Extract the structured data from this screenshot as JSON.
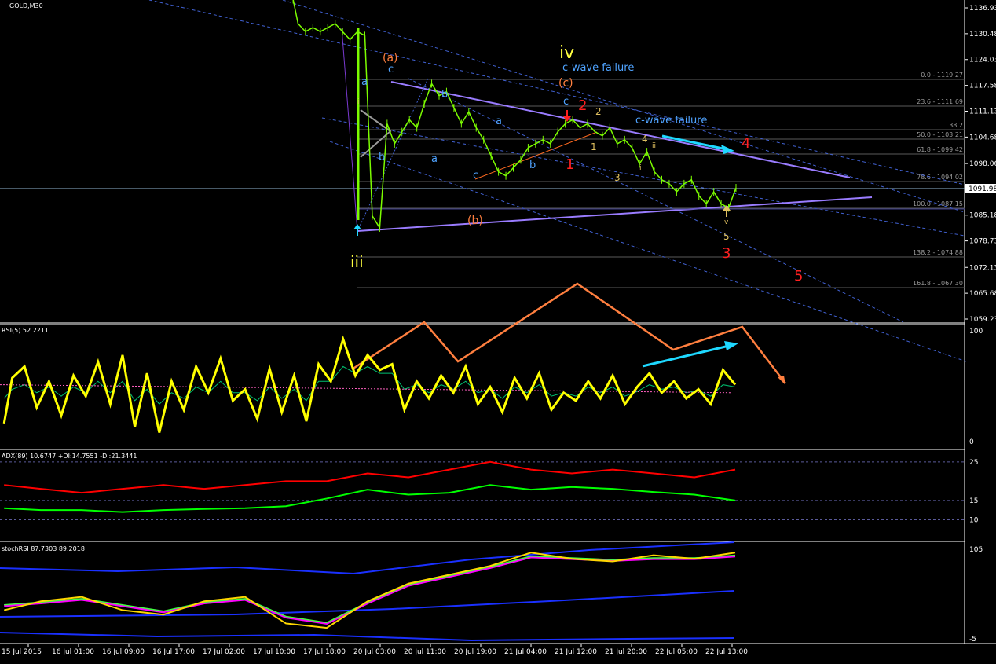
{
  "chart_data": [
    {
      "type": "line",
      "panel": "price",
      "title": "GOLD,M30",
      "y_ticks": [
        "1136.93",
        "1130.48",
        "1124.03",
        "1117.58",
        "1111.13",
        "1104.68",
        "1098.06",
        "1091.98",
        "1085.18",
        "1078.73",
        "1072.13",
        "1065.68",
        "1059.23"
      ],
      "ylim": [
        1059.23,
        1136.93
      ],
      "current_price": "1091.98",
      "price_x": [
        1,
        3,
        6,
        9,
        12,
        15,
        18,
        21,
        24,
        27,
        30,
        33,
        36,
        39,
        42,
        45,
        48,
        51,
        54,
        57,
        60,
        63,
        66,
        69,
        72,
        75,
        78,
        81,
        84,
        87,
        90,
        93,
        96,
        99,
        102,
        105,
        108,
        111,
        114,
        117,
        120,
        123,
        126,
        129,
        132,
        135,
        138,
        141,
        144,
        147,
        150,
        153,
        156,
        159,
        162,
        165,
        168,
        171,
        174,
        177,
        180
      ],
      "price_y": [
        1139,
        1133,
        1131,
        1132,
        1131,
        1132,
        1133,
        1131,
        1129,
        1131,
        1130,
        1085,
        1082,
        1108,
        1103,
        1106,
        1109,
        1107,
        1113,
        1118,
        1115,
        1116,
        1112,
        1108,
        1111,
        1107,
        1104,
        1100,
        1096,
        1095,
        1097,
        1099,
        1102,
        1103,
        1104,
        1103,
        1106,
        1108,
        1109,
        1107,
        1108,
        1106,
        1105,
        1107,
        1103,
        1104,
        1102,
        1098,
        1101,
        1096,
        1094,
        1093,
        1091,
        1093,
        1094,
        1090,
        1088,
        1091,
        1088,
        1087,
        1092
      ],
      "fib_levels": [
        "0.0 - 1119.27",
        "23.6 - 1111.69",
        "38.2",
        "50.0 - 1103.21",
        "61.8 - 1099.42",
        "78.6 - 1094.02",
        "100.0 - 1087.15",
        "138.2 - 1074.88",
        "161.8 - 1067.30"
      ],
      "wave_labels": {
        "iii": "iii",
        "iv": "iv",
        "a_paren": "(a)",
        "b_paren": "(b)",
        "c_paren": "(c)",
        "c_wave_failure_1": "c-wave failure",
        "c_wave_failure_2": "c-wave failure",
        "a": "a",
        "b": "b",
        "c": "c",
        "i": "i",
        "ii": "ii",
        "v": "v",
        "n1": "1",
        "n2": "2",
        "n3": "3",
        "n4": "4",
        "n5": "5"
      }
    },
    {
      "type": "line",
      "panel": "rsi",
      "title": "RSI(5) 52.2211",
      "y_ticks": [
        "100",
        "0"
      ],
      "ylim": [
        0,
        100
      ],
      "x": [
        1,
        3,
        6,
        9,
        12,
        15,
        18,
        21,
        24,
        27,
        30,
        33,
        36,
        39,
        42,
        45,
        48,
        51,
        54,
        57,
        60,
        63,
        66,
        69,
        72,
        75,
        78,
        81,
        84,
        87,
        90,
        93,
        96,
        99,
        102,
        105,
        108,
        111,
        114,
        117,
        120,
        123,
        126,
        129,
        132,
        135,
        138,
        141,
        144,
        147,
        150,
        153,
        156,
        159,
        162,
        165,
        168,
        171,
        174,
        177,
        180
      ],
      "values": [
        18,
        58,
        68,
        32,
        55,
        25,
        60,
        42,
        72,
        35,
        78,
        15,
        62,
        10,
        55,
        30,
        68,
        45,
        75,
        38,
        48,
        22,
        66,
        28,
        60,
        20,
        70,
        55,
        92,
        60,
        78,
        65,
        70,
        30,
        55,
        40,
        60,
        45,
        68,
        35,
        50,
        28,
        58,
        40,
        62,
        30,
        45,
        38,
        55,
        40,
        60,
        35,
        50,
        62,
        45,
        55,
        40,
        48,
        35,
        65,
        52
      ],
      "signal_values": [
        40,
        48,
        52,
        45,
        50,
        42,
        50,
        45,
        55,
        45,
        55,
        38,
        48,
        35,
        45,
        40,
        50,
        45,
        55,
        45,
        45,
        38,
        50,
        40,
        48,
        38,
        55,
        55,
        68,
        62,
        68,
        62,
        62,
        48,
        52,
        45,
        52,
        48,
        55,
        45,
        48,
        40,
        50,
        45,
        52,
        42,
        45,
        42,
        50,
        45,
        50,
        42,
        46,
        52,
        48,
        50,
        45,
        47,
        42,
        52,
        50
      ]
    },
    {
      "type": "line",
      "panel": "adx",
      "title": "ADX(89) 10.6747 +DI:14.7551 -DI:21.3441",
      "y_ticks": [
        "25",
        "15",
        "10"
      ],
      "ylim": [
        5,
        27
      ],
      "x": [
        1,
        10,
        20,
        30,
        40,
        50,
        60,
        70,
        80,
        90,
        100,
        110,
        120,
        130,
        140,
        150,
        160,
        170,
        180
      ],
      "minus_di": [
        19,
        18,
        17,
        18,
        19,
        18,
        19,
        20,
        20,
        22,
        21,
        23,
        25,
        23,
        22,
        23,
        22,
        21,
        23
      ],
      "plus_di": [
        13,
        12.5,
        12.5,
        12,
        12.5,
        12.8,
        13,
        13.5,
        15.5,
        17.8,
        16.5,
        17,
        19,
        17.8,
        18.5,
        18,
        17.2,
        16.5,
        15
      ]
    },
    {
      "type": "line",
      "panel": "stochrsi",
      "title": "stochRSI 87.7303 89.2018",
      "y_ticks": [
        "105",
        "-5"
      ],
      "ylim": [
        -5,
        105
      ],
      "x": [
        1,
        10,
        20,
        30,
        40,
        50,
        60,
        70,
        80,
        90,
        100,
        110,
        120,
        130,
        140,
        150,
        160,
        170,
        180
      ],
      "k_values": [
        30,
        40,
        45,
        30,
        25,
        40,
        45,
        15,
        10,
        40,
        60,
        70,
        80,
        95,
        88,
        85,
        92,
        88,
        95
      ],
      "d_values": [
        35,
        38,
        42,
        35,
        28,
        38,
        42,
        22,
        15,
        38,
        58,
        68,
        78,
        90,
        88,
        86,
        88,
        88,
        91
      ]
    }
  ],
  "x_axis_labels": [
    "15 Jul 2015",
    "16 Jul 01:00",
    "16 Jul 09:00",
    "16 Jul 17:00",
    "17 Jul 02:00",
    "17 Jul 10:00",
    "17 Jul 18:00",
    "20 Jul 03:00",
    "20 Jul 11:00",
    "20 Jul 19:00",
    "21 Jul 04:00",
    "21 Jul 12:00",
    "21 Jul 20:00",
    "22 Jul 05:00",
    "22 Jul 13:00"
  ],
  "colors": {
    "background": "#000000",
    "candle": "#7CFC00",
    "rsi": "#FFFF00",
    "minus_di": "#FF0000",
    "plus_di": "#00FF00",
    "stoch_k": "#FFD700",
    "stoch_d": "#FF00FF",
    "wave_orange": "#FF7F3F",
    "wave_red": "#FF2020",
    "wave_blue": "#4FA3FF",
    "wave_yellow": "#FFFF40",
    "trendline": "#9A7CFF",
    "arrow_cyan": "#1ED8FF"
  }
}
